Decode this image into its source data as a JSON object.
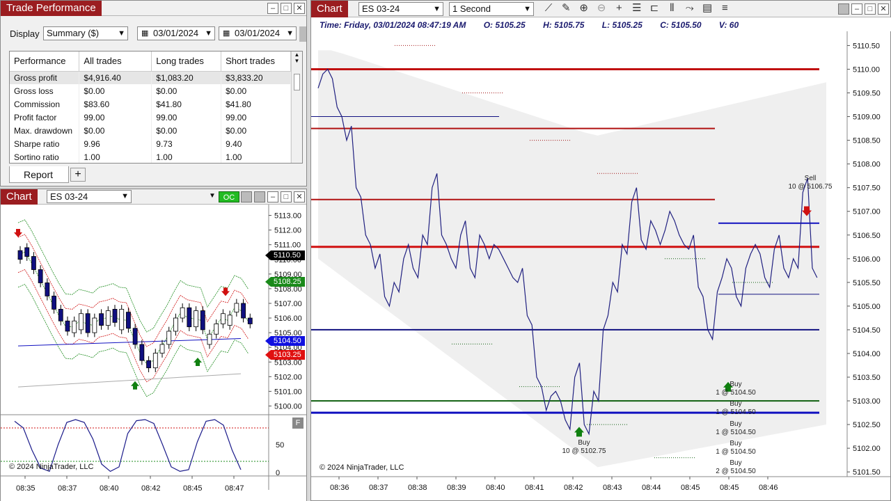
{
  "perf_window": {
    "title": "Trade Performance",
    "display_label": "Display",
    "display_value": "Summary ($)",
    "date_from": "03/01/2024",
    "date_to": "03/01/2024",
    "columns": [
      "Performance",
      "All trades",
      "Long trades",
      "Short trades"
    ],
    "rows": [
      [
        "Gross profit",
        "$4,916.40",
        "$1,083.20",
        "$3,833.20"
      ],
      [
        "Gross loss",
        "$0.00",
        "$0.00",
        "$0.00"
      ],
      [
        "Commission",
        "$83.60",
        "$41.80",
        "$41.80"
      ],
      [
        "Profit factor",
        "99.00",
        "99.00",
        "99.00"
      ],
      [
        "Max. drawdown",
        "$0.00",
        "$0.00",
        "$0.00"
      ],
      [
        "Sharpe ratio",
        "9.96",
        "9.73",
        "9.40"
      ],
      [
        "Sortino ratio",
        "1.00",
        "1.00",
        "1.00"
      ]
    ],
    "tab_report": "Report",
    "tab_add": "+"
  },
  "small_chart": {
    "title": "Chart",
    "instrument": "ES 03-24",
    "oc_badge": "OC",
    "copyright": "© 2024 NinjaTrader, LLC",
    "indicator_btn": "F",
    "price_tags": [
      {
        "label": "5110.50",
        "color": "#000000"
      },
      {
        "label": "5108.25",
        "color": "#1a8a1a"
      },
      {
        "label": "5104.50",
        "color": "#1010e0"
      },
      {
        "label": "5103.25",
        "color": "#e01010"
      }
    ]
  },
  "main_chart": {
    "title": "Chart",
    "instrument": "ES 03-24",
    "interval": "1 Second",
    "info": {
      "time": "Time: Friday, 03/01/2024 08:47:19 AM",
      "open": "O: 5105.25",
      "high": "H: 5105.75",
      "low": "L: 5105.25",
      "close": "C: 5105.50",
      "volume": "V: 60"
    },
    "copyright": "© 2024 NinjaTrader, LLC",
    "trades": [
      {
        "side": "Sell",
        "qty_price": "10 @ 5106.75"
      },
      {
        "side": "Buy",
        "qty_price": "10 @ 5102.75"
      },
      {
        "side": "Buy",
        "qty_price": "1 @ 5104.50"
      },
      {
        "side": "Buy",
        "qty_price": "1 @ 5104.50"
      },
      {
        "side": "Buy",
        "qty_price": "1 @ 5104.50"
      },
      {
        "side": "Buy",
        "qty_price": "1 @ 5104.50"
      },
      {
        "side": "Buy",
        "qty_price": "2 @ 5104.50"
      }
    ]
  },
  "chart_data": [
    {
      "type": "line",
      "title": "",
      "x_ticks": [
        "08:36",
        "08:37",
        "08:38",
        "08:39",
        "08:40",
        "08:41",
        "08:42",
        "08:43",
        "08:44",
        "08:45",
        "08:45",
        "08:46"
      ],
      "y_ticks": [
        "5110.50",
        "5110.00",
        "5109.50",
        "5109.00",
        "5108.50",
        "5108.00",
        "5107.50",
        "5107.00",
        "5106.50",
        "5106.00",
        "5105.50",
        "5105.00",
        "5104.50",
        "5104.00",
        "5103.50",
        "5103.00",
        "5102.50",
        "5102.00",
        "5101.50"
      ],
      "ylim": [
        5101.4,
        5110.8
      ],
      "series": [
        {
          "values": [
            5109.6,
            5110.0,
            5109.2,
            5108.5,
            5107.5,
            5106.5,
            5105.8,
            5105.2,
            5105.5,
            5106.0,
            5105.8,
            5106.5,
            5107.5,
            5106.5,
            5106.0,
            5106.5,
            5105.8,
            5106.5,
            5106.0,
            5106.2,
            5105.8,
            5105.5,
            5104.8,
            5103.5,
            5102.8,
            5103.2,
            5102.6,
            5103.5,
            5102.5,
            5103.2,
            5104.5,
            5105.5,
            5106.3,
            5107.2,
            5106.4,
            5106.8,
            5106.3,
            5107.0,
            5106.5,
            5106.2,
            5105.4,
            5104.5,
            5105.3,
            5106.0,
            5105.2,
            5105.8,
            5106.3,
            5105.6,
            5106.2,
            5105.8,
            5106.0,
            5107.4,
            5105.8
          ]
        }
      ]
    },
    {
      "type": "bar",
      "title": "",
      "x_ticks": [
        "08:35",
        "08:37",
        "08:40",
        "08:42",
        "08:45",
        "08:47"
      ],
      "y_ticks": [
        "5113.00",
        "5112.00",
        "5111.00",
        "5110.00",
        "5109.00",
        "5108.00",
        "5107.00",
        "5106.00",
        "5105.00",
        "5104.00",
        "5103.00",
        "5102.00",
        "5101.00",
        "5100.00"
      ],
      "ylim": [
        5099.5,
        5113.5
      ],
      "candles": [
        {
          "o": 5110.6,
          "c": 5110.0
        },
        {
          "o": 5110.8,
          "c": 5110.2
        },
        {
          "o": 5110.2,
          "c": 5109.3
        },
        {
          "o": 5109.3,
          "c": 5108.4
        },
        {
          "o": 5108.4,
          "c": 5107.5
        },
        {
          "o": 5107.5,
          "c": 5106.6
        },
        {
          "o": 5106.6,
          "c": 5105.8
        },
        {
          "o": 5105.8,
          "c": 5105.1
        },
        {
          "o": 5105.0,
          "c": 5105.8
        },
        {
          "o": 5105.2,
          "c": 5106.3
        },
        {
          "o": 5106.3,
          "c": 5105.0
        },
        {
          "o": 5105.0,
          "c": 5106.0
        },
        {
          "o": 5106.3,
          "c": 5105.5
        },
        {
          "o": 5105.5,
          "c": 5106.5
        },
        {
          "o": 5106.6,
          "c": 5105.7
        },
        {
          "o": 5105.2,
          "c": 5106.6
        },
        {
          "o": 5106.4,
          "c": 5105.3
        },
        {
          "o": 5105.3,
          "c": 5104.2
        },
        {
          "o": 5104.2,
          "c": 5103.1
        },
        {
          "o": 5103.1,
          "c": 5102.6
        },
        {
          "o": 5102.6,
          "c": 5103.6
        },
        {
          "o": 5103.6,
          "c": 5104.2
        },
        {
          "o": 5104.2,
          "c": 5105.1
        },
        {
          "o": 5105.1,
          "c": 5106.0
        },
        {
          "o": 5106.0,
          "c": 5106.7
        },
        {
          "o": 5106.7,
          "c": 5105.4
        },
        {
          "o": 5105.4,
          "c": 5106.5
        },
        {
          "o": 5106.5,
          "c": 5105.2
        },
        {
          "o": 5104.2,
          "c": 5104.9
        },
        {
          "o": 5104.9,
          "c": 5105.6
        },
        {
          "o": 5105.6,
          "c": 5106.3
        },
        {
          "o": 5105.5,
          "c": 5106.2
        },
        {
          "o": 5106.4,
          "c": 5107.0
        },
        {
          "o": 5107.0,
          "c": 5106.0
        },
        {
          "o": 5106.0,
          "c": 5105.6
        }
      ],
      "oscillator_ticks": [
        "50",
        "0"
      ]
    }
  ]
}
